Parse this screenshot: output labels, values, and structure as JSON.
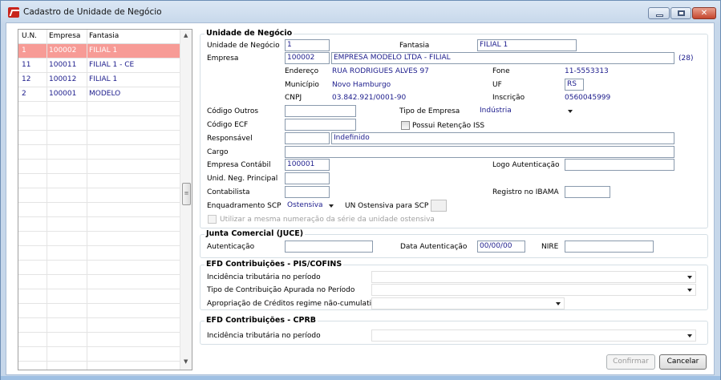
{
  "window": {
    "title": "Cadastro de Unidade de Negócio",
    "close_glyph": "✕"
  },
  "list": {
    "columns": [
      "U.N.",
      "Empresa",
      "Fantasia"
    ],
    "rows": [
      {
        "un": "1",
        "empresa": "100002",
        "fantasia": "FILIAL 1",
        "selected": true
      },
      {
        "un": "11",
        "empresa": "100011",
        "fantasia": "FILIAL 1 - CE"
      },
      {
        "un": "12",
        "empresa": "100012",
        "fantasia": "FILIAL 1"
      },
      {
        "un": "2",
        "empresa": "100001",
        "fantasia": "MODELO"
      }
    ],
    "selected_color": "#f79b96"
  },
  "unidade": {
    "title": "Unidade de Negócio",
    "un_label": "Unidade de Negócio",
    "un_value": "1",
    "fantasia_label": "Fantasia",
    "fantasia_value": "FILIAL 1",
    "empresa_label": "Empresa",
    "empresa_code": "100002",
    "empresa_name": "EMPRESA MODELO LTDA - FILIAL",
    "empresa_count": "(28)",
    "endereco_label": "Endereço",
    "endereco_value": "RUA RODRIGUES ALVES 97",
    "fone_label": "Fone",
    "fone_value": "11-5553313",
    "municipio_label": "Município",
    "municipio_value": "Novo Hamburgo",
    "uf_label": "UF",
    "uf_value": "RS",
    "cnpj_label": "CNPJ",
    "cnpj_value": "03.842.921/0001-90",
    "inscricao_label": "Inscrição",
    "inscricao_value": "0560045999",
    "codigo_outros_label": "Código Outros",
    "codigo_outros_value": "",
    "tipo_empresa_label": "Tipo de Empresa",
    "tipo_empresa_value": "Indústria",
    "codigo_ecf_label": "Código ECF",
    "codigo_ecf_value": "",
    "retencao_iss_label": "Possui Retenção ISS",
    "retencao_iss_checked": false,
    "responsavel_label": "Responsável",
    "responsavel_code": "",
    "responsavel_name": "Indefinido",
    "cargo_label": "Cargo",
    "cargo_value": "",
    "empresa_contabil_label": "Empresa Contábil",
    "empresa_contabil_value": "100001",
    "logo_autenticacao_label": "Logo Autenticação",
    "logo_autenticacao_value": "",
    "unid_neg_principal_label": "Unid. Neg. Principal",
    "unid_neg_principal_value": "",
    "contabilista_label": "Contabilista",
    "contabilista_value": "",
    "registro_ibama_label": "Registro no IBAMA",
    "registro_ibama_value": "",
    "enquadramento_label": "Enquadramento SCP",
    "enquadramento_value": "Ostensiva",
    "un_ostensiva_label": "UN Ostensiva para SCP",
    "un_ostensiva_value": "",
    "mesma_numeracao_label": "Utilizar a mesma numeração da série da unidade ostensiva",
    "mesma_numeracao_checked": false
  },
  "junta": {
    "title": "Junta Comercial (JUCE)",
    "autenticacao_label": "Autenticação",
    "autenticacao_value": "",
    "data_label": "Data Autenticação",
    "data_value": "00/00/00",
    "nire_label": "NIRE",
    "nire_value": ""
  },
  "pis": {
    "title": "EFD Contribuições - PIS/COFINS",
    "incidencia_label": "Incidência tributária no período",
    "incidencia_value": "",
    "tipo_label": "Tipo de Contribuição Apurada no Período",
    "tipo_value": "",
    "apropriacao_label": "Apropriação de Créditos regime não-cumulativo",
    "apropriacao_value": ""
  },
  "cprb": {
    "title": "EFD Contribuições - CPRB",
    "incidencia_label": "Incidência tributária no período",
    "incidencia_value": ""
  },
  "buttons": {
    "confirmar": "Confirmar",
    "cancelar": "Cancelar"
  }
}
